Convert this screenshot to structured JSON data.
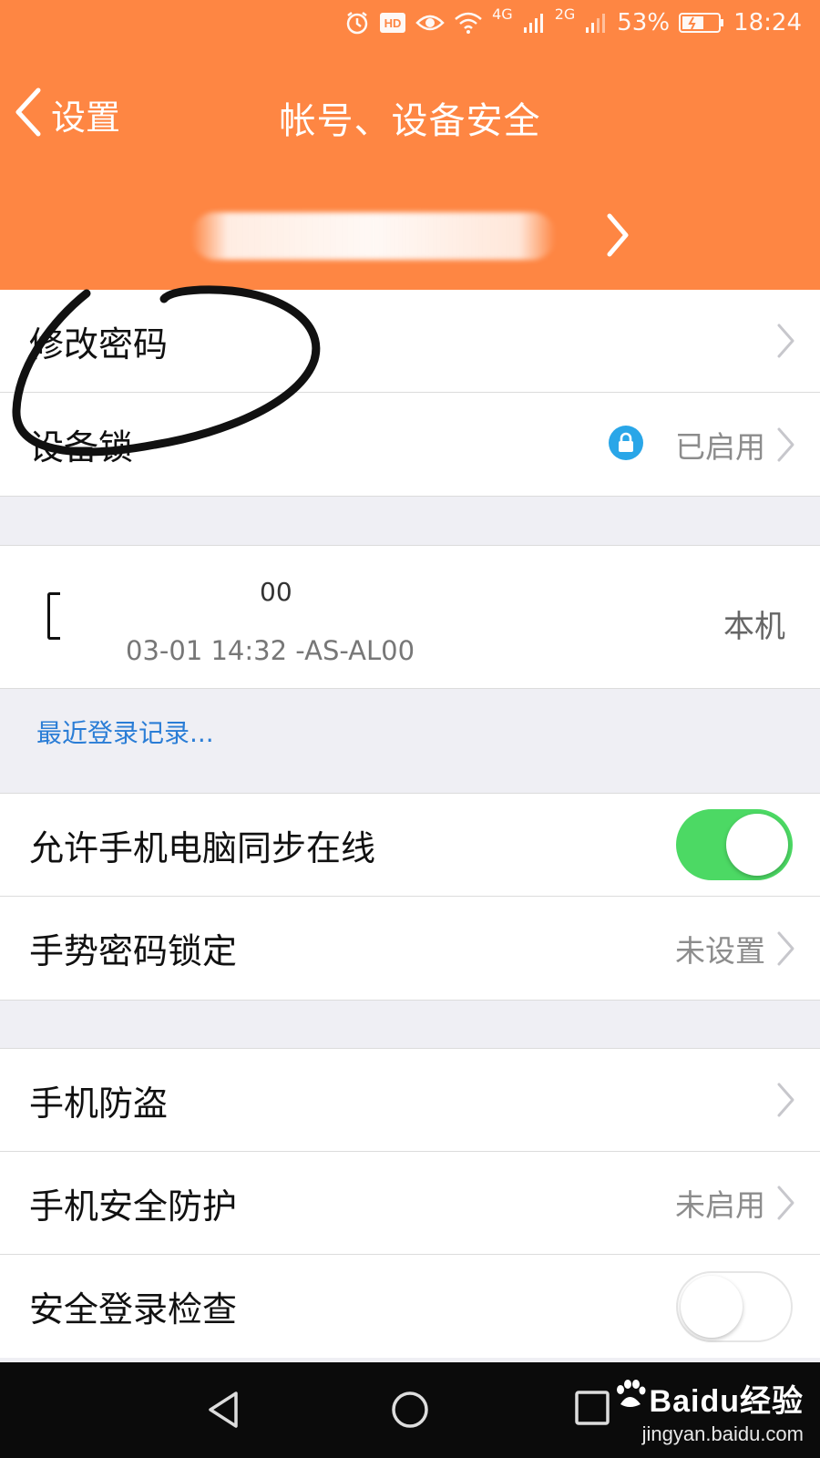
{
  "status_bar": {
    "battery_percent": "53%",
    "time": "18:24",
    "network_labels": [
      "4G",
      "2G"
    ]
  },
  "header": {
    "back_label": "设置",
    "title": "帐号、设备安全",
    "background_color": "#fe8643"
  },
  "security": {
    "change_password": "修改密码",
    "device_lock": "设备锁",
    "device_lock_status": "已启用"
  },
  "device": {
    "name_fragment": "00",
    "login_info": "03-01 14:32 -AS-AL00",
    "tag": "本机"
  },
  "recent_logins_link": "最近登录记录...",
  "settings": {
    "sync_online": "允许手机电脑同步在线",
    "sync_online_enabled": true,
    "gesture_lock": "手势密码锁定",
    "gesture_lock_status": "未设置"
  },
  "protection": {
    "anti_theft": "手机防盗",
    "security_protection": "手机安全防护",
    "security_protection_status": "未启用",
    "login_check": "安全登录检查",
    "login_check_enabled": false
  },
  "watermark": {
    "brand": "Baidu经验",
    "url": "jingyan.baidu.com"
  },
  "colors": {
    "accent_orange": "#fe8643",
    "switch_green": "#4cd964",
    "link_blue": "#2a7dd6",
    "lock_blue": "#29a6e8"
  }
}
